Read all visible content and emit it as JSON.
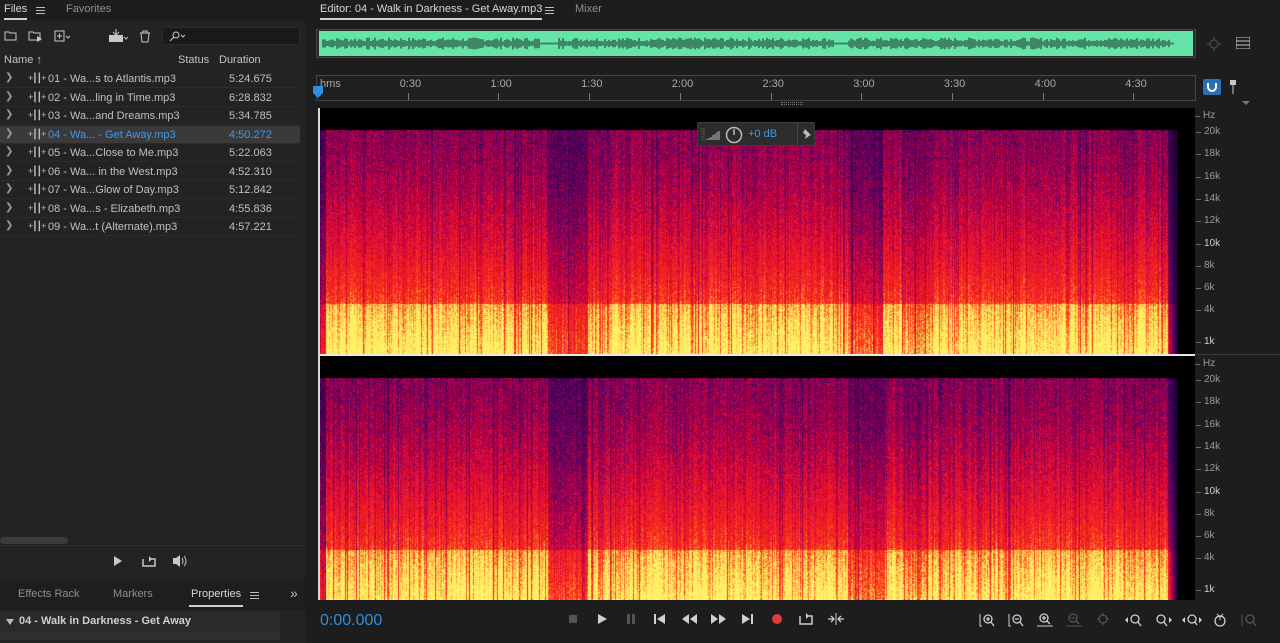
{
  "files_panel": {
    "tabs": [
      "Files",
      "Favorites"
    ],
    "columns": {
      "name": "Name",
      "status": "Status",
      "duration": "Duration"
    },
    "files": [
      {
        "name": "01 - Wa...s to Atlantis.mp3",
        "duration": "5:24.675"
      },
      {
        "name": "02 - Wa...ling in Time.mp3",
        "duration": "6:28.832"
      },
      {
        "name": "03 - Wa...and Dreams.mp3",
        "duration": "5:34.785"
      },
      {
        "name": "04 - Wa... - Get Away.mp3",
        "duration": "4:50.272",
        "selected": true
      },
      {
        "name": "05 - Wa...Close to Me.mp3",
        "duration": "5:22.063"
      },
      {
        "name": "06 - Wa... in the West.mp3",
        "duration": "4:52.310"
      },
      {
        "name": "07 - Wa...Glow of Day.mp3",
        "duration": "5:12.842"
      },
      {
        "name": "08 - Wa...s - Elizabeth.mp3",
        "duration": "4:55.836"
      },
      {
        "name": "09 - Wa...t (Alternate).mp3",
        "duration": "4:57.221"
      }
    ]
  },
  "lower_panel": {
    "tabs": [
      "Effects Rack",
      "Markers",
      "Properties"
    ],
    "property_title": "04 - Walk in Darkness - Get Away"
  },
  "editor": {
    "tab_label": "Editor: 04 - Walk in Darkness - Get Away.mp3",
    "mixer_label": "Mixer",
    "ruler_ticks": [
      "hms",
      "0:30",
      "1:00",
      "1:30",
      "2:00",
      "2:30",
      "3:00",
      "3:30",
      "4:00",
      "4:30"
    ],
    "volume_hud": "+0 dB",
    "hz_unit": "Hz",
    "freq_labels": [
      "20k",
      "18k",
      "16k",
      "14k",
      "12k",
      "10k",
      "8k",
      "6k",
      "4k",
      "1k"
    ],
    "current_time": "0:00.000"
  },
  "icons": {
    "transport": [
      "stop-icon",
      "play-icon",
      "pause-icon",
      "go-to-start-icon",
      "rewind-icon",
      "fast-forward-icon",
      "go-to-end-icon",
      "record-icon",
      "loop-icon",
      "skip-selection-icon"
    ],
    "zoom": [
      "zoom-in-amplitude-icon",
      "zoom-out-amplitude-icon",
      "zoom-in-time-icon",
      "zoom-out-time-icon",
      "zoom-selection-icon",
      "zoom-in-left-icon",
      "zoom-in-right-icon",
      "zoom-full-icon",
      "zoom-spectral-icon",
      "zoom-reset-icon"
    ]
  },
  "colors": {
    "accent": "#3f9ae8",
    "waveform": "#66e4a8",
    "record": "#e33a3a"
  }
}
